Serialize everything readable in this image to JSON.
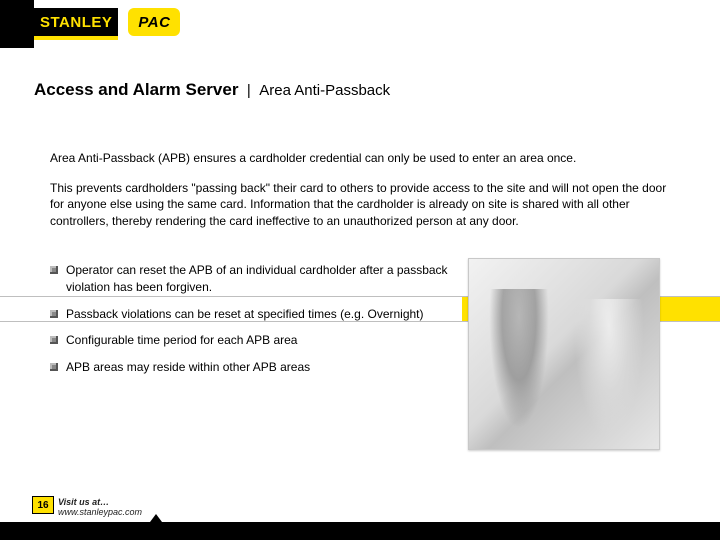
{
  "brand": {
    "logo1": "STANLEY",
    "logo2": "PAC"
  },
  "title": {
    "main": "Access and Alarm Server",
    "sep": "|",
    "sub": "Area Anti-Passback"
  },
  "paragraphs": {
    "p1": "Area Anti-Passback (APB) ensures a cardholder credential can only be used to enter an area once.",
    "p2": "This prevents cardholders \"passing back\" their card to others to provide access to the site and will not open the door for anyone else using the same card. Information that the cardholder is already on site is shared with all other controllers, thereby rendering the card ineffective to an unauthorized person at any door."
  },
  "bullets": {
    "b1": "Operator can reset the APB of an individual cardholder after a passback violation has been forgiven.",
    "b2": "Passback violations can be reset at specified times (e.g. Overnight)",
    "b3": "Configurable time period for each APB area",
    "b4": "APB areas may reside within other APB areas"
  },
  "footer": {
    "page": "16",
    "visit_label": "Visit us at…",
    "visit_url": "www.stanleypac.com"
  }
}
